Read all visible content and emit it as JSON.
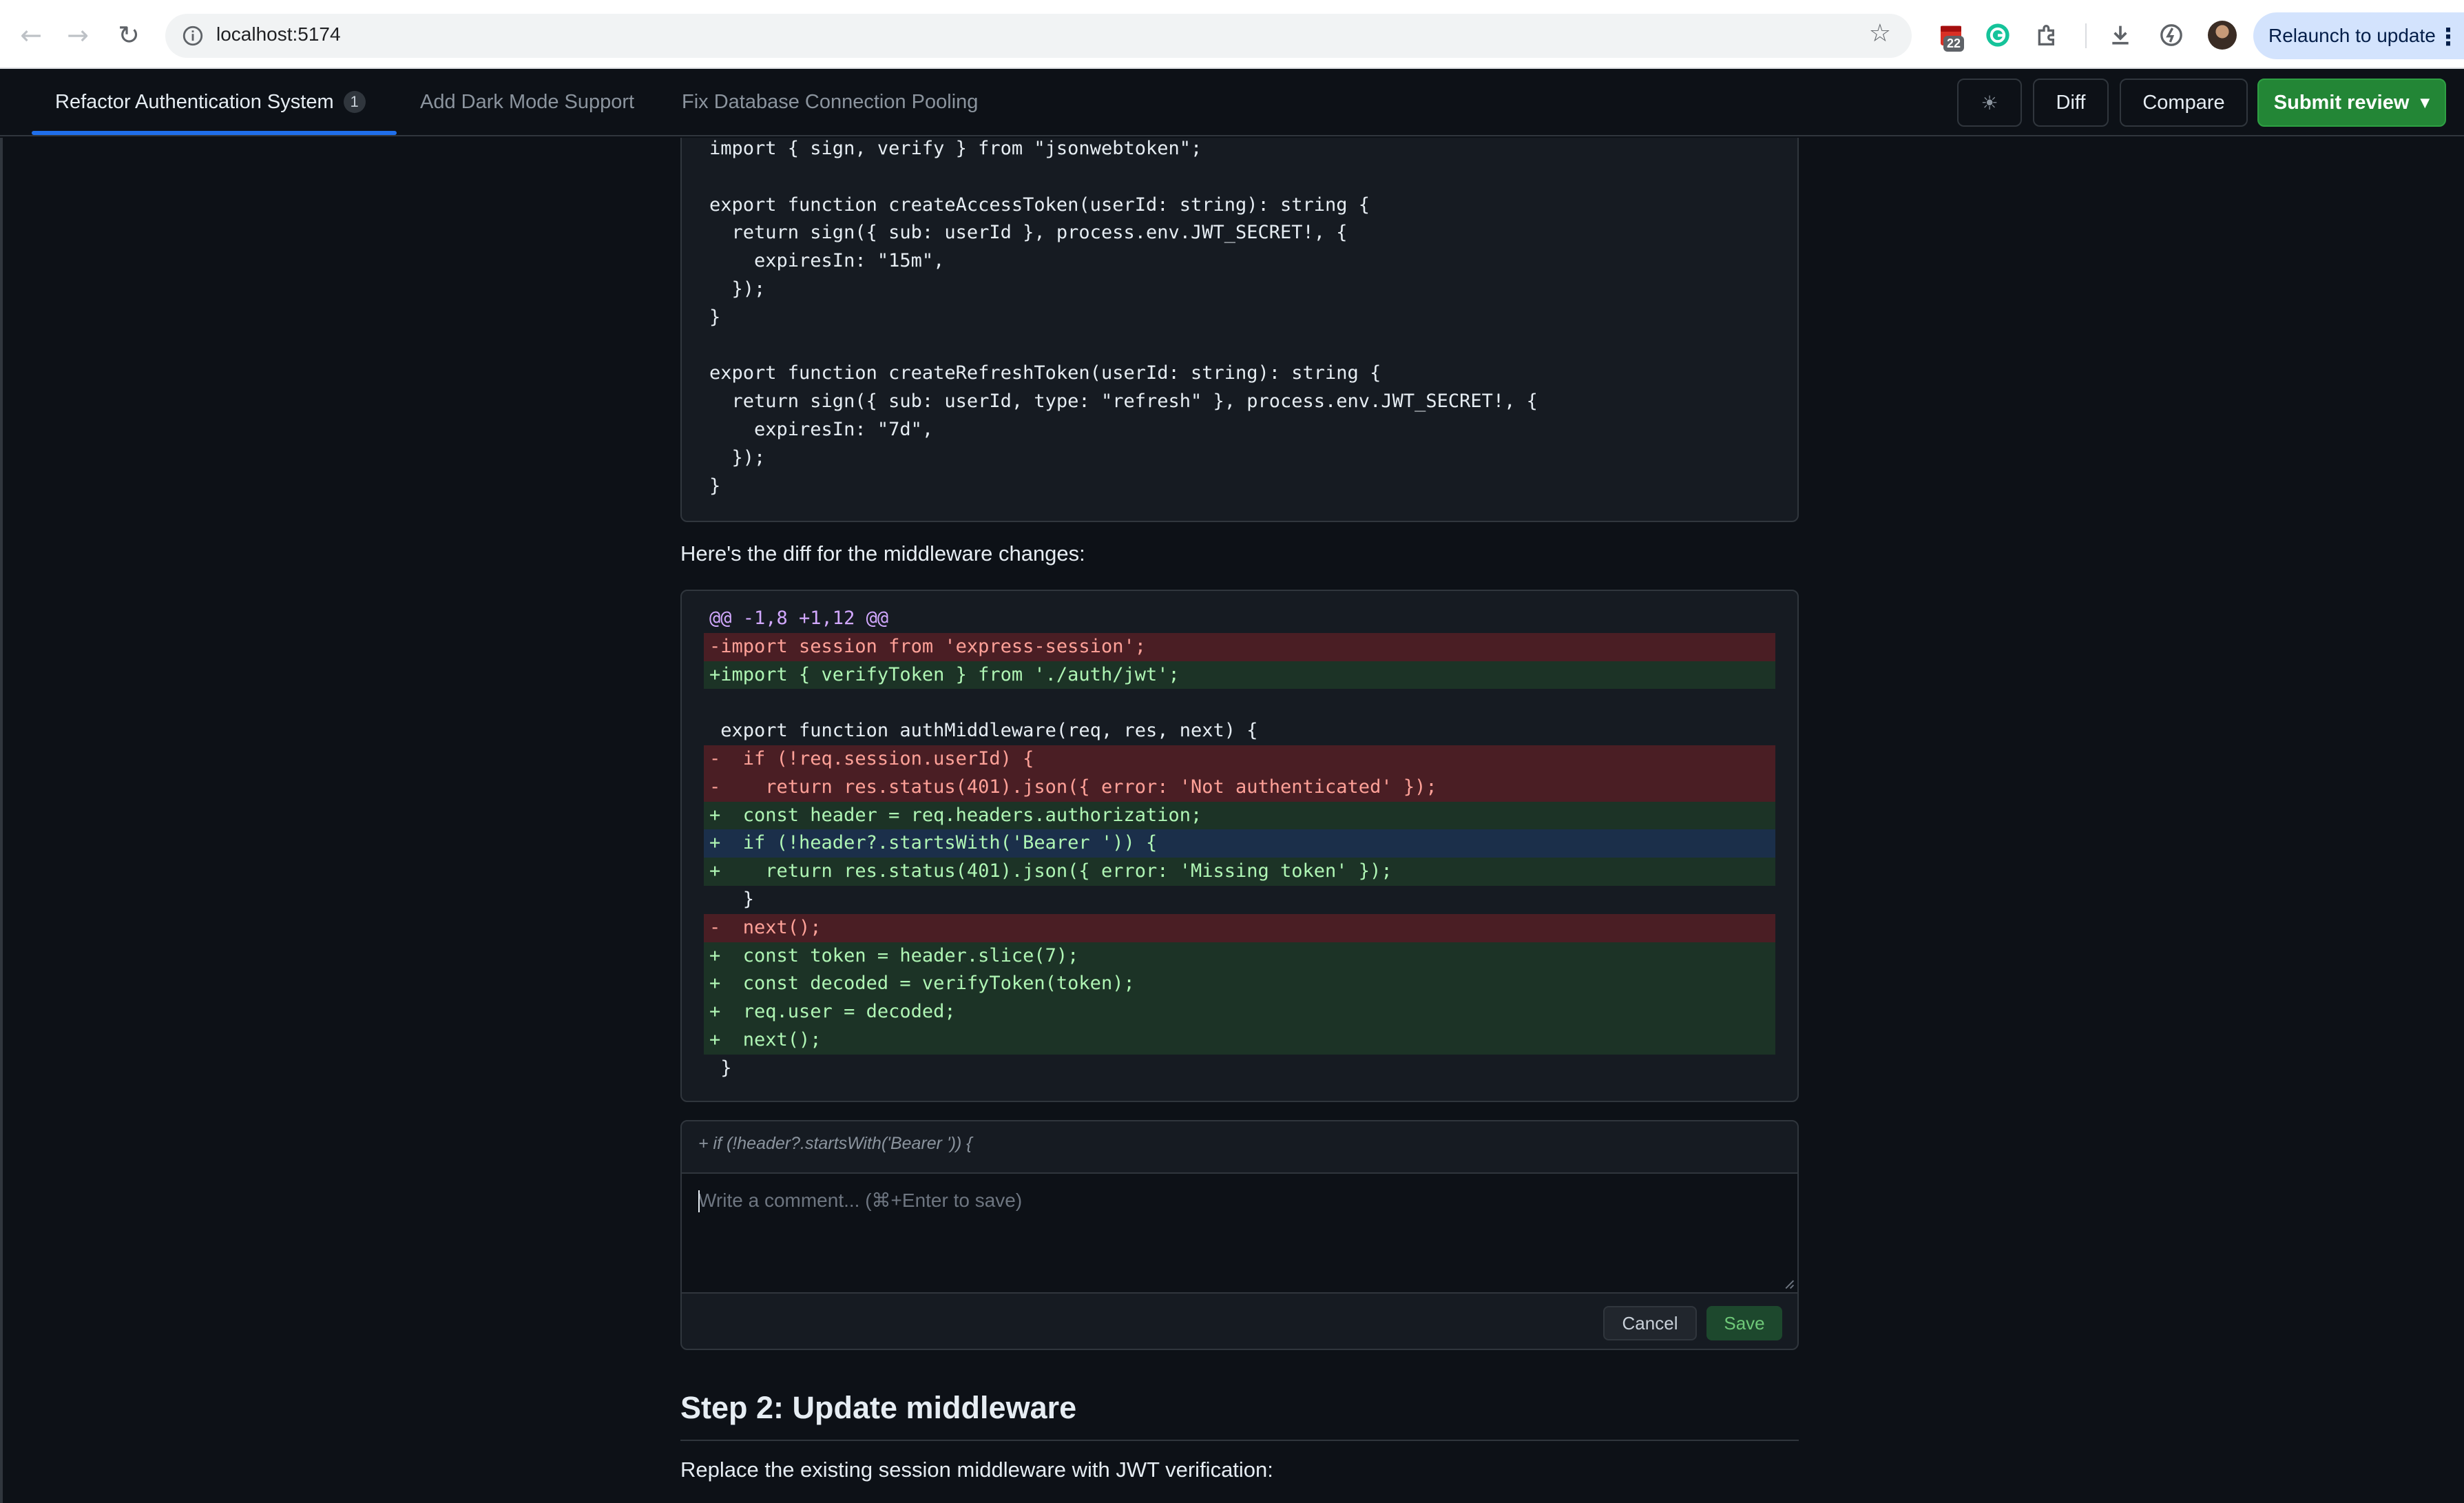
{
  "browser": {
    "url": "localhost:5174",
    "extension_badge": "22",
    "relaunch_label": "Relaunch to update",
    "icons": [
      "back-icon",
      "forward-icon",
      "reload-icon",
      "site-info-icon",
      "bookmark-star-icon",
      "calendar-extension-icon",
      "grammarly-icon",
      "extensions-puzzle-icon",
      "download-icon",
      "performance-icon",
      "profile-avatar",
      "more-menu-icon"
    ]
  },
  "header": {
    "tabs": [
      {
        "label": "Refactor Authentication System",
        "count": "1"
      },
      {
        "label": "Add Dark Mode Support"
      },
      {
        "label": "Fix Database Connection Pooling"
      }
    ],
    "theme_icon": "☀",
    "diff_label": "Diff",
    "compare_label": "Compare",
    "submit_label": "Submit review",
    "accent_color": "#238636",
    "tab_underline_color": "#1f6feb"
  },
  "main": {
    "code_lines": [
      "import { sign, verify } from \"jsonwebtoken\";",
      "",
      "export function createAccessToken(userId: string): string {",
      "  return sign({ sub: userId }, process.env.JWT_SECRET!, {",
      "    expiresIn: \"15m\",",
      "  });",
      "}",
      "",
      "export function createRefreshToken(userId: string): string {",
      "  return sign({ sub: userId, type: \"refresh\" }, process.env.JWT_SECRET!, {",
      "    expiresIn: \"7d\",",
      "  });",
      "}"
    ],
    "diff_intro": "Here's the diff for the middleware changes:",
    "diff_lines": [
      {
        "type": "hunk",
        "text": "@@ -1,8 +1,12 @@"
      },
      {
        "type": "del",
        "text": "-import session from 'express-session';"
      },
      {
        "type": "add",
        "text": "+import { verifyToken } from './auth/jwt';"
      },
      {
        "type": "ctx",
        "text": ""
      },
      {
        "type": "ctx",
        "text": " export function authMiddleware(req, res, next) {"
      },
      {
        "type": "del",
        "text": "-  if (!req.session.userId) {"
      },
      {
        "type": "del",
        "text": "-    return res.status(401).json({ error: 'Not authenticated' });"
      },
      {
        "type": "add",
        "text": "+  const header = req.headers.authorization;"
      },
      {
        "type": "sel",
        "text": "+  if (!header?.startsWith('Bearer ')) {"
      },
      {
        "type": "add",
        "text": "+    return res.status(401).json({ error: 'Missing token' });"
      },
      {
        "type": "ctx",
        "text": "   }"
      },
      {
        "type": "del",
        "text": "-  next();"
      },
      {
        "type": "add",
        "text": "+  const token = header.slice(7);"
      },
      {
        "type": "add",
        "text": "+  const decoded = verifyToken(token);"
      },
      {
        "type": "add",
        "text": "+  req.user = decoded;"
      },
      {
        "type": "add",
        "text": "+  next();"
      },
      {
        "type": "ctx",
        "text": " }"
      }
    ],
    "comment": {
      "reference": "+ if (!header?.startsWith('Bearer ')) {",
      "value": "",
      "placeholder": "Write a comment... (⌘+Enter to save)",
      "cancel_label": "Cancel",
      "save_label": "Save"
    },
    "step_heading": "Step 2: Update middleware",
    "step_text": "Replace the existing session middleware with JWT verification:"
  }
}
